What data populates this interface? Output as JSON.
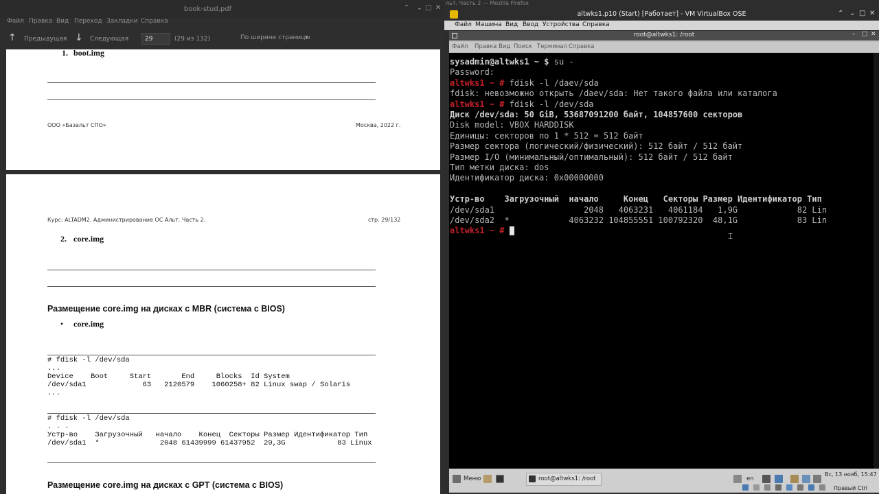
{
  "pdf_viewer": {
    "title": "book-stud.pdf",
    "menu": [
      "Файл",
      "Правка",
      "Вид",
      "Переход",
      "Закладки",
      "Справка"
    ],
    "toolbar": {
      "prev_label": "Предыдущая",
      "next_label": "Следующая",
      "page_value": "29",
      "page_count": "(29 из 132)",
      "zoom_value": "По ширине страницы"
    },
    "page1": {
      "bullet_item": "boot.img",
      "footer_left": "ООО «Базальт СПО»",
      "footer_right": "Москва, 2022 г."
    },
    "page2": {
      "header_left": "Курс: ALTADM2. Администрирование ОС Альт. Часть 2.",
      "header_right": "стр. 29/132",
      "item_number": "2.",
      "item_title": "core.img",
      "section1_title": "Размещение core.img на дисках с MBR (система с BIOS)",
      "bullet": "•",
      "bullet_item": "core.img",
      "code1": "# fdisk -l /dev/sda\n...\nDevice    Boot     Start       End     Blocks  Id System\n/dev/sda1             63   2120579    1060258+ 82 Linux swap / Solaris\n...",
      "code2": "# fdisk -l /dev/sda\n. . .\nУстр-во    Загрузочный   начало    Конец  Секторы Размер Идентификатор Тип\n/dev/sda1  *              2048 61439999 61437952  29,3G            83 Linux",
      "section2_title": "Размещение core.img на дисках с GPT (система с BIOS)"
    }
  },
  "background_window_title": "льт. Часть 2 — Mozilla Firefox",
  "vm": {
    "title": "altwks1.p10 (Start) [Работает] - VM VirtualBox OSE",
    "menu": [
      "Файл",
      "Машина",
      "Вид",
      "Ввод",
      "Устройства",
      "Справка"
    ],
    "terminal_title": "root@altwks1: /root",
    "terminal_menu": [
      "Файл",
      "Правка",
      "Вид",
      "Поиск",
      "Терминал",
      "Справка"
    ],
    "terminal_lines": [
      {
        "prompt": "sysadmin@altwks1 ~ $ ",
        "text": "su -",
        "style": "userprompt"
      },
      {
        "prompt": "",
        "text": "Password:",
        "style": "normal"
      },
      {
        "prompt": "altwks1 ~ # ",
        "text": "fdisk -l /daev/sda",
        "style": "rootprompt"
      },
      {
        "prompt": "",
        "text": "fdisk: невозможно открыть /daev/sda: Нет такого файла или каталога",
        "style": "normal"
      },
      {
        "prompt": "altwks1 ~ # ",
        "text": "fdisk -l /dev/sda",
        "style": "rootprompt"
      },
      {
        "prompt": "",
        "text": "Диск /dev/sda: 50 GiB, 53687091200 байт, 104857600 секторов",
        "style": "bold"
      },
      {
        "prompt": "",
        "text": "Disk model: VBOX HARDDISK",
        "style": "normal"
      },
      {
        "prompt": "",
        "text": "Единицы: секторов по 1 * 512 = 512 байт",
        "style": "normal"
      },
      {
        "prompt": "",
        "text": "Размер сектора (логический/физический): 512 байт / 512 байт",
        "style": "normal"
      },
      {
        "prompt": "",
        "text": "Размер I/O (минимальный/оптимальный): 512 байт / 512 байт",
        "style": "normal"
      },
      {
        "prompt": "",
        "text": "Тип метки диска: dos",
        "style": "normal"
      },
      {
        "prompt": "",
        "text": "Идентификатор диска: 0x00000000",
        "style": "normal"
      },
      {
        "prompt": "",
        "text": "",
        "style": "normal"
      },
      {
        "prompt": "",
        "text": "Устр-во    Загрузочный  начало     Конец   Секторы Размер Идентификатор Тип",
        "style": "bold"
      },
      {
        "prompt": "",
        "text": "/dev/sda1                  2048   4063231   4061184   1,9G            82 Lin",
        "style": "normal"
      },
      {
        "prompt": "",
        "text": "/dev/sda2  *            4063232 104855551 100792320  48,1G            83 Lin",
        "style": "normal"
      },
      {
        "prompt": "altwks1 ~ # ",
        "text": "",
        "style": "cursor"
      }
    ],
    "taskbar": {
      "menu_label": "Меню",
      "task_label": "root@altwks1: /root",
      "lang": "en",
      "clock": "Вс, 13 нояб, 15:47",
      "host_key": "Правый Ctrl"
    }
  },
  "colors": {
    "prompt_red": "#c3202a",
    "terminal_bg": "#000000",
    "pdf_bg": "#2e2e2e"
  }
}
